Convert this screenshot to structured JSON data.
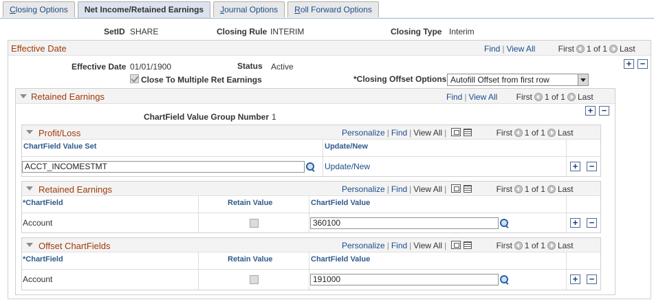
{
  "tabs": [
    {
      "label": "Closing Options",
      "hotkey": "C",
      "rest": "losing Options"
    },
    {
      "label": "Net Income/Retained Earnings"
    },
    {
      "label": "Journal Options",
      "hotkey": "J",
      "rest": "ournal Options"
    },
    {
      "label": "Roll Forward Options",
      "hotkey": "R",
      "rest": "oll Forward Options"
    }
  ],
  "header": {
    "setid_label": "SetID",
    "setid_value": "SHARE",
    "rule_label": "Closing Rule",
    "rule_value": "INTERIM",
    "type_label": "Closing Type",
    "type_value": "Interim"
  },
  "effective_date": {
    "title": "Effective Date",
    "find": "Find",
    "view_all": "View All",
    "first": "First",
    "count": "1 of 1",
    "last": "Last",
    "date_label": "Effective Date",
    "date_value": "01/01/1900",
    "status_label": "Status",
    "status_value": "Active",
    "close_multiple_label": "Close To Multiple Ret Earnings",
    "close_multiple_checked": true,
    "offset_label": "*Closing Offset Options",
    "offset_value": "Autofill Offset from first row"
  },
  "retained_earnings": {
    "title": "Retained Earnings",
    "find": "Find",
    "view_all": "View All",
    "first": "First",
    "count": "1 of 1",
    "last": "Last",
    "group_label": "ChartField Value Group Number",
    "group_value": "1"
  },
  "profit_loss": {
    "title": "Profit/Loss",
    "personalize": "Personalize",
    "find": "Find",
    "view_all": "View All",
    "first": "First",
    "count": "1 of 1",
    "last": "Last",
    "col1": "ChartField Value Set",
    "col2": "Update/New",
    "row_value": "ACCT_INCOMESTMT",
    "row_link": "Update/New"
  },
  "re_grid": {
    "title": "Retained Earnings",
    "personalize": "Personalize",
    "find": "Find",
    "view_all": "View All",
    "first": "First",
    "count": "1 of 1",
    "last": "Last",
    "col1": "*ChartField",
    "col2": "Retain Value",
    "col3": "ChartField Value",
    "row_chartfield": "Account",
    "row_value": "360100"
  },
  "offset_grid": {
    "title": "Offset ChartFields",
    "personalize": "Personalize",
    "find": "Find",
    "view_all": "View All",
    "first": "First",
    "count": "1 of 1",
    "last": "Last",
    "col1": "*ChartField",
    "col2": "Retain Value",
    "col3": "ChartField Value",
    "row_chartfield": "Account",
    "row_value": "191000"
  },
  "symbols": {
    "plus": "+",
    "minus": "−",
    "sep": "|"
  }
}
